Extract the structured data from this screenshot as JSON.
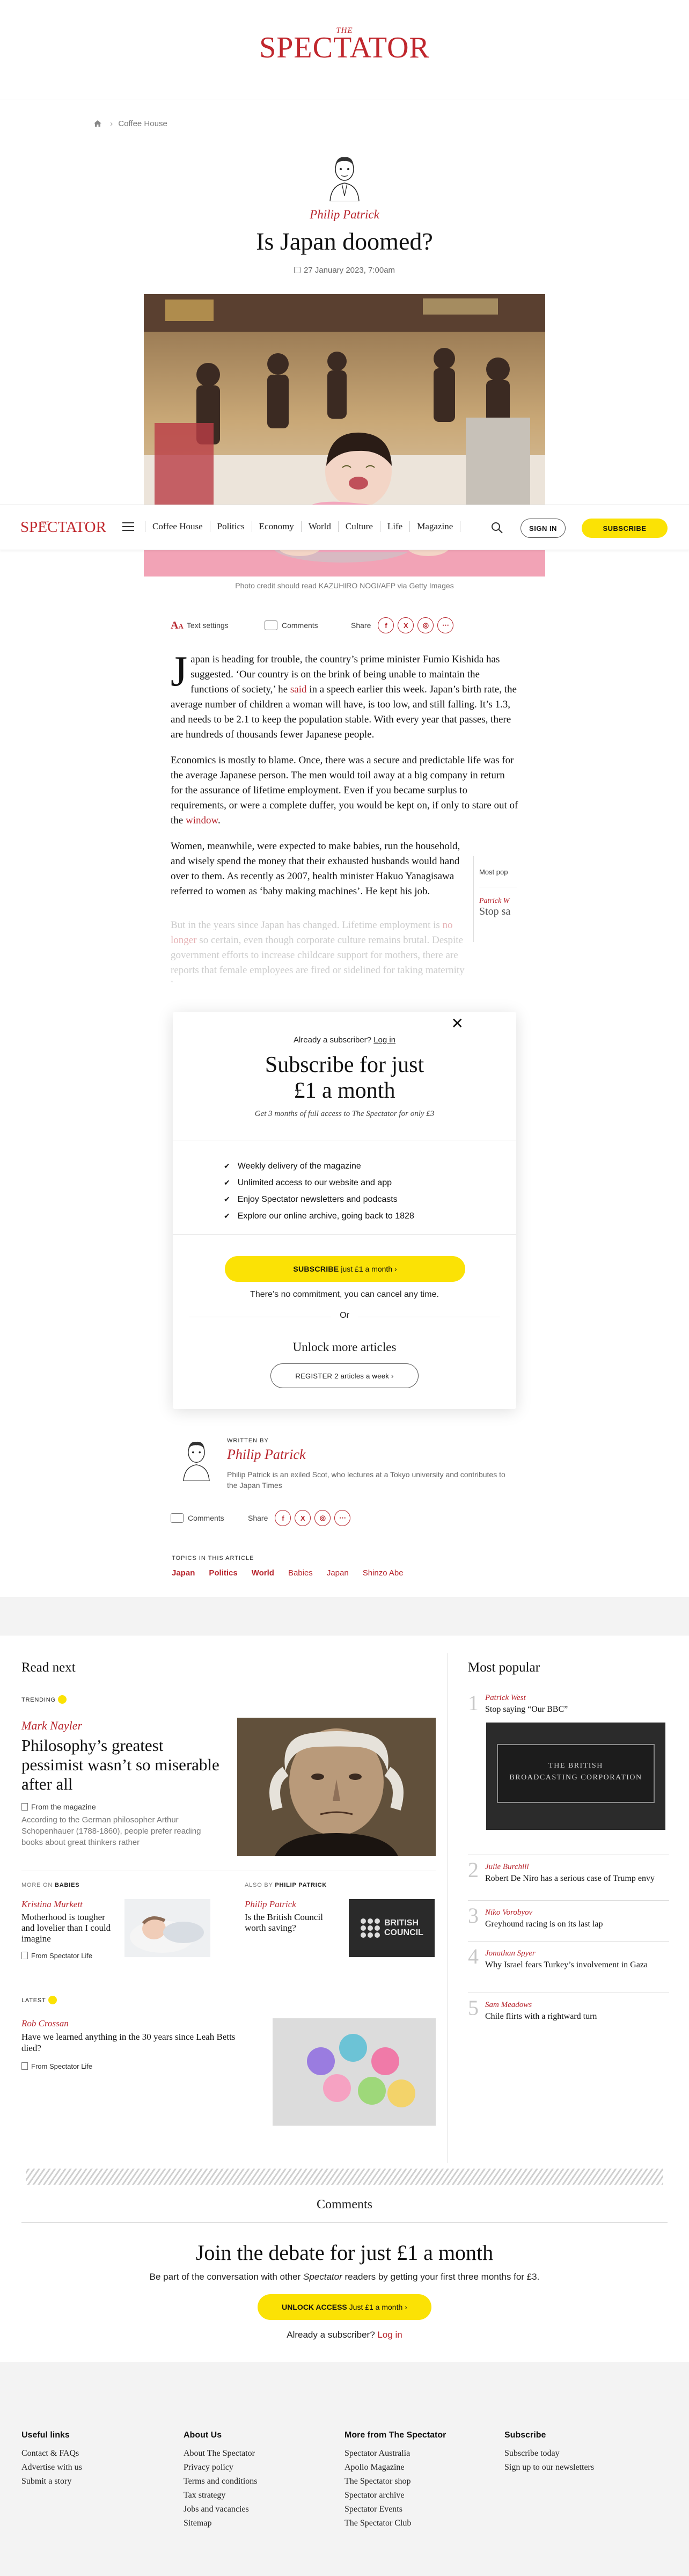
{
  "brand": {
    "the": "THE",
    "name": "SPECTATOR",
    "accent": "#b8262e",
    "cta_yellow": "#fbe205"
  },
  "breadcrumb": {
    "icon": "home-icon",
    "section": "Coffee House"
  },
  "article": {
    "author": "Philip Patrick",
    "title": "Is Japan doomed?",
    "date": "27 January 2023, 7:00am",
    "photo_credit": "Photo credit should read KAZUHIRO NOGI/AFP via Getty Images",
    "p1_dropcap": "J",
    "p1_a": "apan is heading for trouble, the country’s prime minister Fumio Kishida has suggested. ‘Our country is on the brink of being unable to maintain the functions of society,’ he ",
    "p1_link": "said",
    "p1_b": " in a speech earlier this week. Japan’s birth rate, the average number of children a woman will have, is too low, and still falling. It’s 1.3, and needs to be 2.1 to keep the population stable. With every year that passes, there are hundreds of thousands fewer Japanese people.",
    "p2_a": "Economics is mostly to blame. Once, there was a secure and predictable life was for the average Japanese person. The men would toil away at a big company in return for the assurance of lifetime employment. Even if you became surplus to requirements, or were a complete duffer, you would be kept on, if only to stare out of the ",
    "p2_link": "window",
    "p2_b": ".",
    "p3": "Women, meanwhile, were expected to make babies, run the household, and wisely spend the money that their exhausted husbands would hand over to them. As recently as 2007, health minister Hakuo Yanagisawa referred to women as ‘baby making machines’. He kept his job.",
    "p4_a": "But in the years since Japan has changed. Lifetime employment is ",
    "p4_link": "no longer",
    "p4_b": " so certain, even though corporate culture remains brutal. Despite government efforts to increase childcare support for mothers, there are reports that female employees are fired or sidelined for taking maternity leave."
  },
  "nav": {
    "links": [
      "Coffee House",
      "Politics",
      "Economy",
      "World",
      "Culture",
      "Life",
      "Magazine"
    ],
    "signin": "SIGN IN",
    "subscribe": "SUBSCRIBE"
  },
  "tools": {
    "text_settings": "Text settings",
    "comments": "Comments",
    "share": "Share"
  },
  "most_pop_peek": {
    "label": "Most pop",
    "author": "Patrick W",
    "title": "Stop sa"
  },
  "paywall": {
    "already": "Already a subscriber?",
    "login": "Log in",
    "title_line1": "Subscribe for just",
    "title_line2": "£1 a month",
    "sub": "Get 3 months of full access to The Spectator for only £3",
    "benefits": [
      "Weekly delivery of the magazine",
      "Unlimited access to our website and app",
      "Enjoy Spectator newsletters and podcasts",
      "Explore our online archive, going back to 1828"
    ],
    "cta_bold": "SUBSCRIBE",
    "cta_rest": "just £1 a month",
    "no_commit": "There’s no commitment, you can cancel any time.",
    "or": "Or",
    "unlock": "Unlock more articles",
    "register": "REGISTER 2 articles a week"
  },
  "author_box": {
    "written_by": "WRITTEN BY",
    "name": "Philip Patrick",
    "bio": "Philip Patrick is an exiled Scot, who lectures at a Tokyo university and contributes to the Japan Times"
  },
  "topics": {
    "label": "TOPICS IN THIS ARTICLE",
    "items": [
      "Japan",
      "Politics",
      "World",
      "Babies",
      "Japan",
      "Shinzo Abe"
    ]
  },
  "read_next": {
    "title": "Read next",
    "trending": "TRENDING",
    "feature_author": "Mark Nayler",
    "feature_title": "Philosophy’s greatest pessimist wasn’t so miserable after all",
    "feature_source": "From the magazine",
    "feature_summary": "According to the German philosopher Arthur Schopenhauer (1788-1860), people prefer reading books about great thinkers rather",
    "more_on_label": "MORE ON",
    "more_on_topic": "BABIES",
    "more_on_author": "Kristina Murkett",
    "more_on_title": "Motherhood is tougher and lovelier than I could imagine",
    "more_on_source": "From Spectator Life",
    "also_by_label": "ALSO BY",
    "also_by_author_label": "PHILIP PATRICK",
    "also_by_author": "Philip Patrick",
    "also_by_title": "Is the British Council worth saving?",
    "bc_logo_line1": "BRITISH",
    "bc_logo_line2": "COUNCIL",
    "latest": "LATEST",
    "latest_author": "Rob Crossan",
    "latest_title": "Have we learned anything in the 30 years since Leah Betts died?",
    "latest_source": "From Spectator Life"
  },
  "most_popular": {
    "title": "Most popular",
    "sign_line1": "THE BRITISH",
    "sign_line2": "BROADCASTING CORPORATION",
    "items": [
      {
        "num": "1",
        "author": "Patrick West",
        "title": "Stop saying “Our BBC”"
      },
      {
        "num": "2",
        "author": "Julie Burchill",
        "title": "Robert De Niro has a serious case of Trump envy"
      },
      {
        "num": "3",
        "author": "Niko Vorobyov",
        "title": "Greyhound racing is on its last lap"
      },
      {
        "num": "4",
        "author": "Jonathan Spyer",
        "title": "Why Israel fears Turkey’s involvement in Gaza"
      },
      {
        "num": "5",
        "author": "Sam Meadows",
        "title": "Chile flirts with a rightward turn"
      }
    ]
  },
  "comments": {
    "label": "Comments",
    "debate_title": "Join the debate for just £1 a month",
    "debate_sub_a": "Be part of the conversation with other ",
    "debate_sub_em": "Spectator",
    "debate_sub_b": " readers by getting your first three months for £3.",
    "unlock_bold": "UNLOCK ACCESS",
    "unlock_rest": "Just £1 a month",
    "already": "Already a subscriber?",
    "login": "Log in"
  },
  "footer": {
    "cols": [
      {
        "heading": "Useful links",
        "links": [
          "Contact & FAQs",
          "Advertise with us",
          "Submit a story"
        ]
      },
      {
        "heading": "About Us",
        "links": [
          "About The Spectator",
          "Privacy policy",
          "Terms and conditions",
          "Tax strategy",
          "Jobs and vacancies",
          "Sitemap"
        ]
      },
      {
        "heading": "More from The Spectator",
        "links": [
          "Spectator Australia",
          "Apollo Magazine",
          "The Spectator shop",
          "Spectator archive",
          "Spectator Events",
          "The Spectator Club"
        ]
      },
      {
        "heading": "Subscribe",
        "links": [
          "Subscribe today",
          "Sign up to our newsletters"
        ]
      }
    ]
  }
}
